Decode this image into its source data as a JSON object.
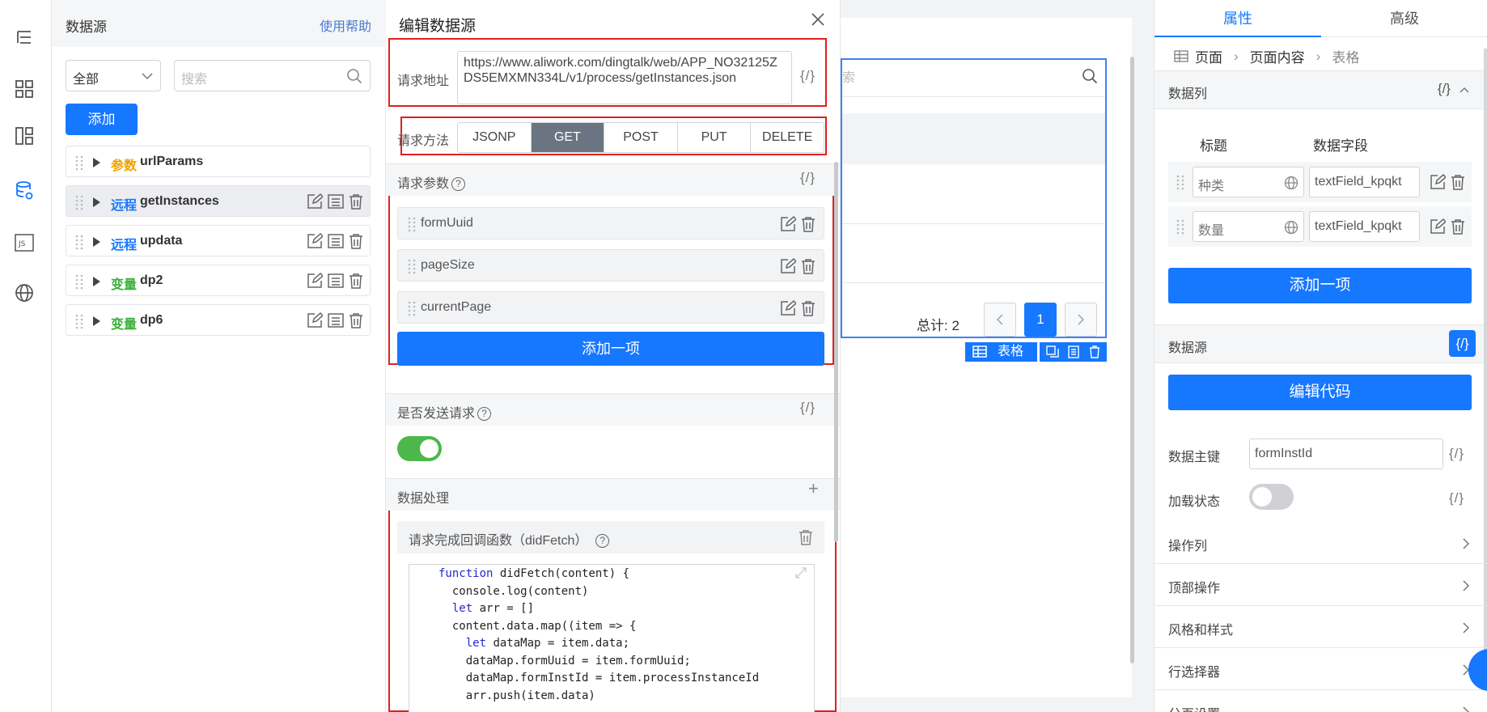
{
  "datasource": {
    "title": "数据源",
    "help": "使用帮助",
    "filter_value": "全部",
    "search_placeholder": "搜索",
    "add_label": "添加",
    "items": [
      {
        "kind": "参数",
        "kind_color": "#f0a000",
        "name": "urlParams",
        "selected": false
      },
      {
        "kind": "远程",
        "kind_color": "#1677ff",
        "name": "getInstances",
        "selected": true
      },
      {
        "kind": "远程",
        "kind_color": "#1677ff",
        "name": "updata",
        "selected": false
      },
      {
        "kind": "变量",
        "kind_color": "#3ab03a",
        "name": "dp2",
        "selected": false
      },
      {
        "kind": "变量",
        "kind_color": "#3ab03a",
        "name": "dp6",
        "selected": false
      }
    ]
  },
  "modal": {
    "title": "编辑数据源",
    "url_label": "请求地址",
    "url_value": "https://www.aliwork.com/dingtalk/web/APP_NO32125ZDS5EMXMN334L/v1/process/getInstances.json",
    "code_icon": "{/}",
    "method_label": "请求方法",
    "methods": [
      "JSONP",
      "GET",
      "POST",
      "PUT",
      "DELETE"
    ],
    "method_selected": "GET",
    "params_label": "请求参数",
    "params": [
      "formUuid",
      "pageSize",
      "currentPage"
    ],
    "add_item": "添加一项",
    "send_label": "是否发送请求",
    "send_enabled": true,
    "process_label": "数据处理",
    "plus": "+",
    "didfetch_label": "请求完成回调函数（didFetch）",
    "code_lines": [
      "function didFetch(content) {",
      "  console.log(content)",
      "  let arr = []",
      "  content.data.map((item => {",
      "    let dataMap = item.data;",
      "    dataMap.formUuid = item.formUuid;",
      "    dataMap.formInstId = item.processInstanceId",
      "    arr.push(item.data)"
    ]
  },
  "canvas": {
    "search_fragment": "索",
    "total": "总计: 2",
    "page": "1",
    "table_tag": "表格"
  },
  "props": {
    "tab_attr": "属性",
    "tab_adv": "高级",
    "crumbs": [
      "页面",
      "页面内容",
      "表格"
    ],
    "columns_title": "数据列",
    "col_title_head": "标题",
    "col_field_head": "数据字段",
    "columns": [
      {
        "title": "种类",
        "field": "textField_kpqkt"
      },
      {
        "title": "数量",
        "field": "textField_kpqkt"
      }
    ],
    "add_item": "添加一项",
    "datasource_title": "数据源",
    "edit_code": "编辑代码",
    "pk_label": "数据主键",
    "pk_value": "formInstId",
    "loading_label": "加载状态",
    "loading_enabled": false,
    "rows": [
      "操作列",
      "顶部操作",
      "风格和样式",
      "行选择器",
      "分页设置"
    ],
    "code_icon": "{/}"
  }
}
